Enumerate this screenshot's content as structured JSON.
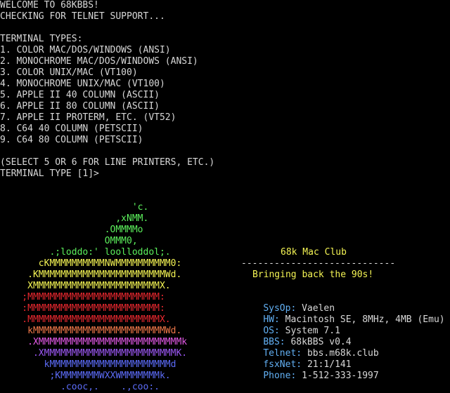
{
  "terminal": {
    "welcome": "WELCOME TO 68KBBS!",
    "checking": "CHECKING FOR TELNET SUPPORT...",
    "types_header": "TERMINAL TYPES:",
    "types": [
      "1. COLOR MAC/DOS/WINDOWS (ANSI)",
      "2. MONOCHROME MAC/DOS/WINDOWS (ANSI)",
      "3. COLOR UNIX/MAC (VT100)",
      "4. MONOCHROME UNIX/MAC (VT100)",
      "5. APPLE II 40 COLUMN (ASCII)",
      "6. APPLE II 80 COLUMN (ASCII)",
      "7. APPLE II PROTERM, ETC. (VT52)",
      "8. C64 40 COLUMN (PETSCII)",
      "9. C64 80 COLUMN (PETSCII)"
    ],
    "note": "(SELECT 5 OR 6 FOR LINE PRINTERS, ETC.)",
    "prompt": "TERMINAL TYPE [1]>"
  },
  "logo_art": [
    {
      "text": "                        'c.",
      "color": "green"
    },
    {
      "text": "                     ,xNMM.",
      "color": "green"
    },
    {
      "text": "                   .OMMMMo",
      "color": "green"
    },
    {
      "text": "                   OMMM0,",
      "color": "green"
    },
    {
      "text": "         .;loddo:' loolloddol;.",
      "color": "green"
    },
    {
      "text": "       cKMMMMMMMMMMNWMMMMMMMMMM0:",
      "color": "yellow"
    },
    {
      "text": "     .KMMMMMMMMMMMMMMMMMMMMMMMWd.",
      "color": "yellow"
    },
    {
      "text": "     XMMMMMMMMMMMMMMMMMMMMMMMX.",
      "color": "yellow"
    },
    {
      "text": "    ;MMMMMMMMMMMMMMMMMMMMMMMM:",
      "color": "red"
    },
    {
      "text": "    :MMMMMMMMMMMMMMMMMMMMMMMM:",
      "color": "red"
    },
    {
      "text": "    .MMMMMMMMMMMMMMMMMMMMMMMMX.",
      "color": "red"
    },
    {
      "text": "     kMMMMMMMMMMMMMMMMMMMMMMMMWd.",
      "color": "orange"
    },
    {
      "text": "     .XMMMMMMMMMMMMMMMMMMMMMMMMMMk",
      "color": "magenta"
    },
    {
      "text": "      .XMMMMMMMMMMMMMMMMMMMMMMMMK.",
      "color": "purple"
    },
    {
      "text": "        kMMMMMMMMMMMMMMMMMMMMMMd",
      "color": "blue"
    },
    {
      "text": "         ;KMMMMMMMWXXWMMMMMMMk.",
      "color": "blue"
    },
    {
      "text": "           .cooc,.    .,coo:.",
      "color": "blue"
    }
  ],
  "club": {
    "title": "68k Mac Club",
    "rule": "----------------------------",
    "tagline": "Bringing back the 90s!",
    "info": [
      {
        "key": "SysOp:",
        "value": "Vaelen"
      },
      {
        "key": "HW:",
        "value": "Macintosh SE, 8MHz, 4MB (Emu)"
      },
      {
        "key": "OS:",
        "value": "System 7.1"
      },
      {
        "key": "BBS:",
        "value": "68kBBS v0.4"
      },
      {
        "key": "Telnet:",
        "value": "bbs.m68k.club"
      },
      {
        "key": "fsxNet:",
        "value": "21:1/141"
      },
      {
        "key": "Phone:",
        "value": "1-512-333-1997"
      }
    ]
  },
  "colors": {
    "background": "#000000",
    "text": "#d8d8d8",
    "green": "#5cf05c",
    "yellow": "#f4f454",
    "red": "#e8282f",
    "orange": "#f0784a",
    "magenta": "#e45ae8",
    "purple": "#9c58f4",
    "blue": "#5c6cf8",
    "label": "#62b0f4"
  }
}
